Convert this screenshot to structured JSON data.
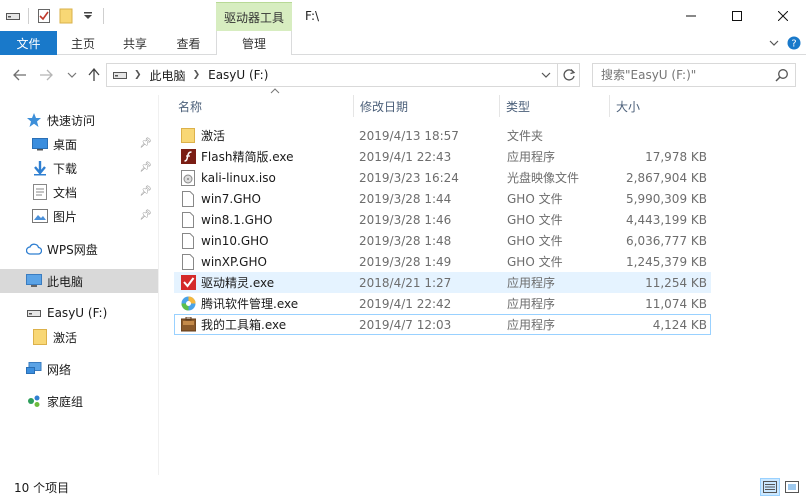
{
  "titlebar": {
    "contextual_tab": "驱动器工具",
    "path_title": "F:\\",
    "controls": [
      "minimize-icon",
      "maximize-icon",
      "close-icon"
    ]
  },
  "ribbon": {
    "tabs": [
      {
        "label": "文件"
      },
      {
        "label": "主页"
      },
      {
        "label": "共享"
      },
      {
        "label": "查看"
      },
      {
        "label": "管理"
      }
    ]
  },
  "address": {
    "crumbs": [
      "此电脑",
      "EasyU (F:)"
    ],
    "search_placeholder": "搜索\"EasyU (F:)\""
  },
  "sidebar": {
    "items": [
      {
        "label": "快速访问",
        "icon": "star-icon"
      },
      {
        "label": "桌面",
        "icon": "desktop-icon"
      },
      {
        "label": "下载",
        "icon": "download-icon"
      },
      {
        "label": "文档",
        "icon": "document-icon"
      },
      {
        "label": "图片",
        "icon": "picture-icon"
      },
      {
        "label": "WPS网盘",
        "icon": "cloud-icon"
      },
      {
        "label": "此电脑",
        "icon": "computer-icon"
      },
      {
        "label": "EasyU (F:)",
        "icon": "drive-icon"
      },
      {
        "label": "激活",
        "icon": "folder-icon"
      },
      {
        "label": "网络",
        "icon": "network-icon"
      },
      {
        "label": "家庭组",
        "icon": "homegroup-icon"
      }
    ]
  },
  "columns": {
    "name": "名称",
    "date": "修改日期",
    "type": "类型",
    "size": "大小"
  },
  "files": [
    {
      "name": "激活",
      "date": "2019/4/13 18:57",
      "type": "文件夹",
      "size": "",
      "icon": "folder-icon"
    },
    {
      "name": "Flash精简版.exe",
      "date": "2019/4/1 22:43",
      "type": "应用程序",
      "size": "17,978 KB",
      "icon": "flash-app-icon"
    },
    {
      "name": "kali-linux.iso",
      "date": "2019/3/23 16:24",
      "type": "光盘映像文件",
      "size": "2,867,904 KB",
      "icon": "disc-image-icon"
    },
    {
      "name": "win7.GHO",
      "date": "2019/3/28 1:44",
      "type": "GHO 文件",
      "size": "5,990,309 KB",
      "icon": "file-icon"
    },
    {
      "name": "win8.1.GHO",
      "date": "2019/3/28 1:46",
      "type": "GHO 文件",
      "size": "4,443,199 KB",
      "icon": "file-icon"
    },
    {
      "name": "win10.GHO",
      "date": "2019/3/28 1:48",
      "type": "GHO 文件",
      "size": "6,036,777 KB",
      "icon": "file-icon"
    },
    {
      "name": "winXP.GHO",
      "date": "2019/3/28 1:49",
      "type": "GHO 文件",
      "size": "1,245,379 KB",
      "icon": "file-icon"
    },
    {
      "name": "驱动精灵.exe",
      "date": "2018/4/21 1:27",
      "type": "应用程序",
      "size": "11,254 KB",
      "icon": "driver-app-icon"
    },
    {
      "name": "腾讯软件管理.exe",
      "date": "2019/4/1 22:42",
      "type": "应用程序",
      "size": "11,074 KB",
      "icon": "tencent-app-icon"
    },
    {
      "name": "我的工具箱.exe",
      "date": "2019/4/7 12:03",
      "type": "应用程序",
      "size": "4,124 KB",
      "icon": "toolbox-app-icon"
    }
  ],
  "status": {
    "count": "10 个项目"
  },
  "colors": {
    "accent": "#1979ca",
    "contextual": "#d7edc0",
    "selection": "#cce8ff"
  }
}
